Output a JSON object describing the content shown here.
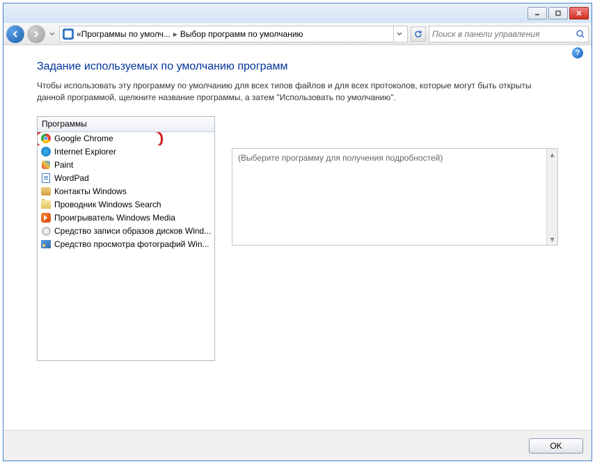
{
  "breadcrumb": {
    "prefix": "«",
    "item1": "Программы по умолч...",
    "item2": "Выбор программ по умолчанию"
  },
  "search": {
    "placeholder": "Поиск в панели управления"
  },
  "page": {
    "title": "Задание используемых по умолчанию программ",
    "description": "Чтобы использовать эту программу по умолчанию для всех типов файлов и для всех протоколов, которые могут быть открыты данной программой, щелкните название программы, а затем \"Использовать по умолчанию\"."
  },
  "list": {
    "header": "Программы",
    "items": [
      "Google Chrome",
      "Internet Explorer",
      "Paint",
      "WordPad",
      "Контакты Windows",
      "Проводник Windows Search",
      "Проигрыватель Windows Media",
      "Средство записи образов дисков Wind...",
      "Средство просмотра фотографий Win..."
    ]
  },
  "detail": {
    "placeholder": "(Выберите программу для получения подробностей)"
  },
  "footer": {
    "ok": "OK"
  }
}
